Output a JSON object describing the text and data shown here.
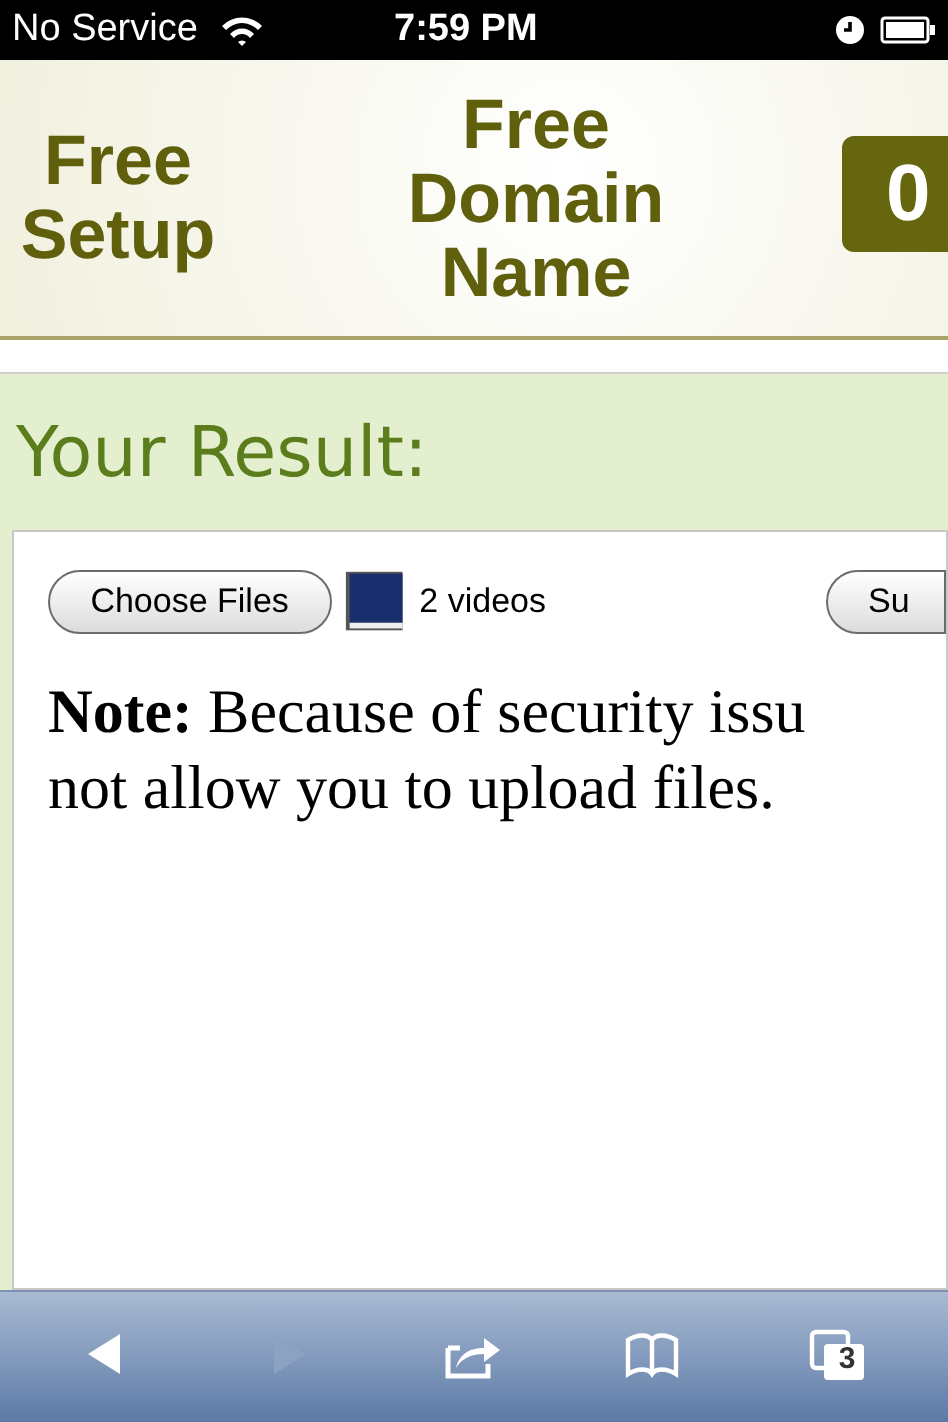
{
  "status_bar": {
    "carrier": "No Service",
    "time": "7:59 PM"
  },
  "banner": {
    "items": [
      "Free Setup",
      "Free Domain Name"
    ],
    "badge": "0"
  },
  "result": {
    "heading": "Your Result:",
    "choose_button": "Choose Files",
    "file_count": "2 videos",
    "submit_button": "Su",
    "note_lines": [
      "**Note:** Because of security issu",
      "not allow you to upload files."
    ]
  },
  "toolbar": [
    {
      "kind": "back",
      "disabled": false
    },
    {
      "kind": "forward",
      "disabled": true
    },
    {
      "kind": "share",
      "disabled": false
    },
    {
      "kind": "bookmarks",
      "disabled": false
    },
    {
      "kind": "tabs",
      "disabled": false,
      "count": "3"
    }
  ]
}
